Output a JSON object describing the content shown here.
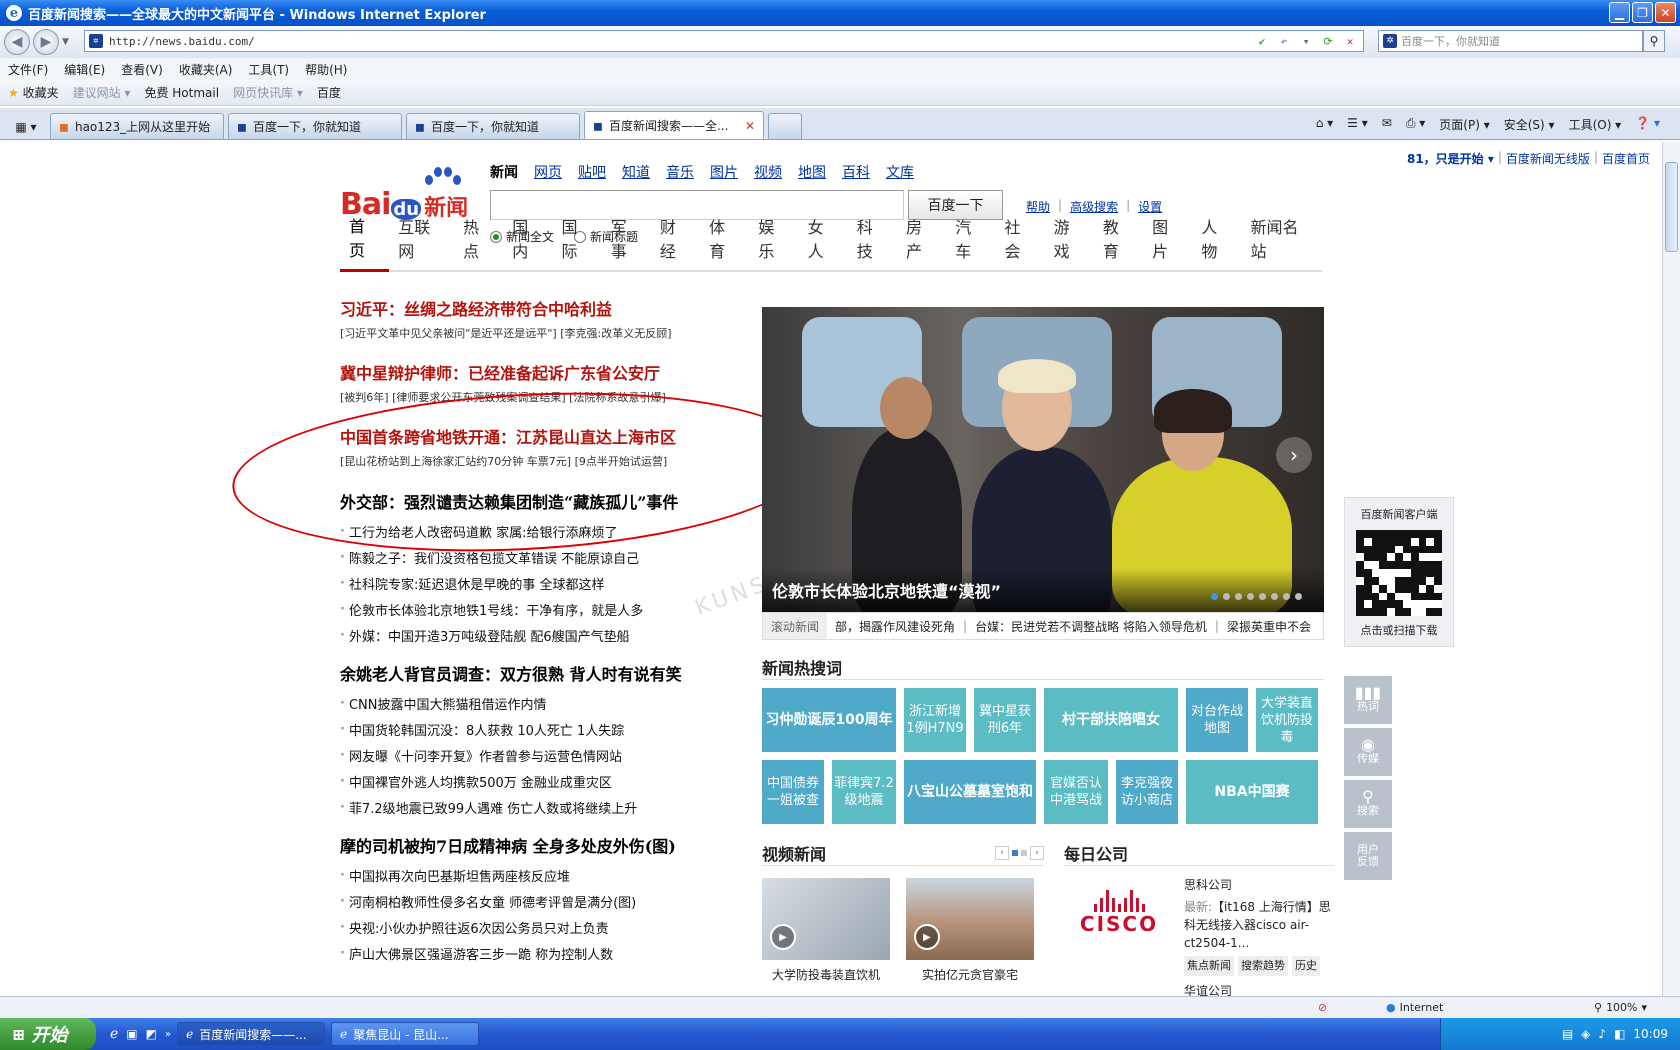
{
  "window": {
    "title": "百度新闻搜索——全球最大的中文新闻平台 - Windows Internet Explorer"
  },
  "address": {
    "url": "http://news.baidu.com/",
    "search_placeholder": "百度一下，你就知道"
  },
  "menu": [
    "文件(F)",
    "编辑(E)",
    "查看(V)",
    "收藏夹(A)",
    "工具(T)",
    "帮助(H)"
  ],
  "favorites": {
    "label": "收藏夹",
    "items": [
      "建议网站 ▾",
      "免费 Hotmail",
      "网页快讯库 ▾",
      "百度"
    ]
  },
  "tabs": [
    "hao123_上网从这里开始",
    "百度一下，你就知道",
    "百度一下，你就知道",
    "百度新闻搜索——全..."
  ],
  "tab_tools": [
    "页面(P) ▾",
    "安全(S) ▾",
    "工具(O) ▾"
  ],
  "page": {
    "toplinks": {
      "a": "81，只是开始 ▾",
      "b": "百度新闻无线版",
      "c": "百度首页"
    },
    "logo": {
      "bai": "Bai",
      "du": "du",
      "news": "新闻"
    },
    "search_tabs": [
      "新闻",
      "网页",
      "贴吧",
      "知道",
      "音乐",
      "图片",
      "视频",
      "地图",
      "百科",
      "文库"
    ],
    "search_button": "百度一下",
    "help_links": [
      "帮助",
      "高级搜索",
      "设置"
    ],
    "radio": [
      "新闻全文",
      "新闻标题"
    ],
    "nav": [
      "首页",
      "互联网",
      "热点",
      "国内",
      "国际",
      "军事",
      "财经",
      "体育",
      "娱乐",
      "女人",
      "科技",
      "房产",
      "汽车",
      "社会",
      "游戏",
      "教育",
      "图片",
      "人物",
      "新闻名站"
    ],
    "headlines": [
      {
        "title": "习近平：丝绸之路经济带符合中哈利益",
        "sub": "[习近平文革中见父亲被问\"是近平还是远平\"] [李克强:改革义无反顾]"
      },
      {
        "title": "冀中星辩护律师：已经准备起诉广东省公安厅",
        "sub": "[被判6年] [律师要求公开东莞致残案调查结果] [法院称系故意引爆]"
      },
      {
        "title": "中国首条跨省地铁开通：江苏昆山直达上海市区",
        "sub": "[昆山花桥站到上海徐家汇站约70分钟 车票7元] [9点半开始试运营]"
      }
    ],
    "block1": {
      "title": "外交部：强烈谴责达赖集团制造“藏族孤儿”事件",
      "items": [
        "工行为给老人改密码道歉 家属:给银行添麻烦了",
        "陈毅之子：我们没资格包揽文革错误 不能原谅自己",
        "社科院专家:延迟退休是早晚的事 全球都这样",
        "伦敦市长体验北京地铁1号线：干净有序，就是人多",
        "外媒：中国开造3万吨级登陆舰 配6艘国产气垫船"
      ]
    },
    "block2": {
      "title": "余姚老人背官员调查：双方很熟 背人时有说有笑",
      "items": [
        "CNN披露中国大熊猫租借运作内情",
        "中国货轮韩国沉没：8人获救 10人死亡 1人失踪",
        "网友曝《十问李开复》作者曾参与运营色情网站",
        "中国裸官外逃人均携款500万 金融业成重灾区",
        "菲7.2级地震已致99人遇难 伤亡人数或将继续上升"
      ]
    },
    "block3": {
      "title": "摩的司机被拘7日成精神病 全身多处皮外伤(图)",
      "items": [
        "中国拟再次向巴基斯坦售两座核反应堆",
        "河南桐柏教师性侵多名女童 师德考评曾是满分(图)",
        "央视:小伙办护照往返6次因公务员只对上负责",
        "庐山大佛景区强逼游客三步一跪 称为控制人数"
      ]
    },
    "hero_caption": "伦敦市长体验北京地铁遭“漠视”",
    "ticker": {
      "label": "滚动新闻",
      "items": [
        "部，揭露作风建设死角",
        "台媒：民进党若不调整战略 将陷入领导危机",
        "梁振英重申不会"
      ]
    },
    "hotwords_title": "新闻热搜词",
    "hotwords": [
      "习仲勋诞辰100周年",
      "浙江新增1例H7N9",
      "冀中星获刑6年",
      "村干部扶陪唱女",
      "对台作战地图",
      "大学装直饮机防投毒",
      "中国债券一姐被查",
      "菲律宾7.2级地震",
      "八宝山公墓墓室饱和",
      "官媒否认中港骂战",
      "李克强夜访小商店",
      "NBA中国赛"
    ],
    "video": {
      "title": "视频新闻",
      "items": [
        "大学防投毒装直饮机",
        "实拍亿元贪官豪宅"
      ]
    },
    "company": {
      "title": "每日公司",
      "name": "思科公司",
      "latest_label": "最新:",
      "latest": "【it168 上海行情】思科无线接入器cisco air-ct2504-1...",
      "logo": "CISCO",
      "tags": [
        "焦点新闻",
        "搜索趋势",
        "历史"
      ],
      "next": "华谊公司"
    },
    "qr": {
      "title": "百度新闻客户端",
      "caption": "点击或扫描下载"
    },
    "side_tools": [
      {
        "icon": "▮▮▮",
        "label": "热词"
      },
      {
        "icon": "◉",
        "label": "传媒"
      },
      {
        "icon": "⚲",
        "label": "搜索"
      },
      {
        "icon": "",
        "label": "用户反馈"
      }
    ],
    "watermark": "KUNSHAN BBS"
  },
  "status": {
    "zone": "Internet",
    "zoom": "100%"
  },
  "taskbar": {
    "start": "开始",
    "items": [
      "百度新闻搜索——...",
      "聚焦昆山 - 昆山..."
    ],
    "clock": "10:09"
  },
  "colors": {
    "accent": "#b5120c",
    "hot": "#5bbcc4",
    "link": "#0033a0"
  }
}
